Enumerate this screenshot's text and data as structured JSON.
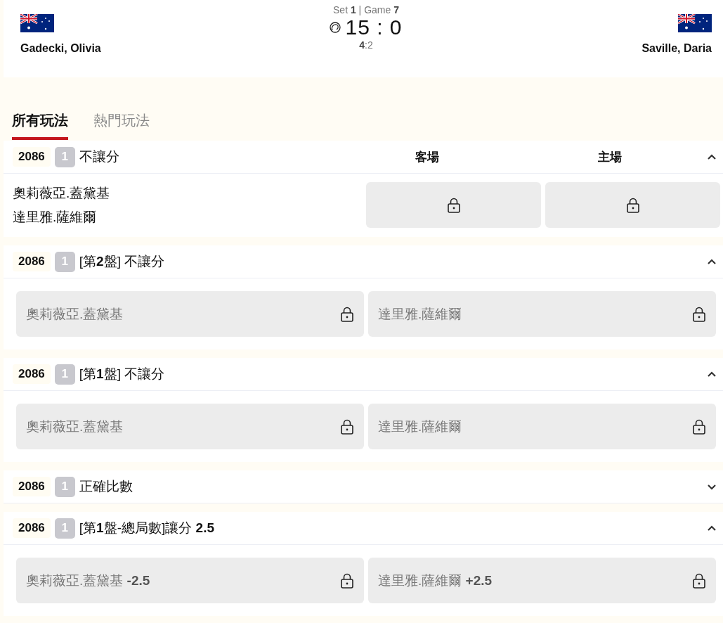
{
  "match": {
    "home": {
      "name": "Gadecki, Olivia",
      "serving": true
    },
    "away": {
      "name": "Saville, Daria",
      "serving": false
    },
    "set_info": "Set **1** | Game **7**",
    "score": "15 : 0",
    "games": "**4**:2"
  },
  "tabs": [
    {
      "label": "所有玩法",
      "selected": true
    },
    {
      "label": "熱門玩法",
      "selected": false
    }
  ],
  "markets": [
    {
      "kind": "table",
      "code": "2086",
      "badge": "1",
      "title": "不讓分",
      "expanded": true,
      "columns": [
        "客場",
        "主場"
      ],
      "teams": [
        "奧莉薇亞.蓋黛基",
        "達里雅.薩維爾"
      ],
      "cells": [
        {
          "locked": true
        },
        {
          "locked": true
        }
      ]
    },
    {
      "kind": "pair",
      "code": "2086",
      "badge": "1",
      "title": "[第**2**盤] 不讓分",
      "expanded": true,
      "options": [
        {
          "label": "奧莉薇亞.蓋黛基",
          "locked": true
        },
        {
          "label": "達里雅.薩維爾",
          "locked": true
        }
      ]
    },
    {
      "kind": "pair",
      "code": "2086",
      "badge": "1",
      "title": "[第**1**盤] 不讓分",
      "expanded": true,
      "options": [
        {
          "label": "奧莉薇亞.蓋黛基",
          "locked": true
        },
        {
          "label": "達里雅.薩維爾",
          "locked": true
        }
      ]
    },
    {
      "kind": "pair",
      "code": "2086",
      "badge": "1",
      "title": "正確比數",
      "expanded": false
    },
    {
      "kind": "pair",
      "code": "2086",
      "badge": "1",
      "title": "[第**1**盤-總局數]讓分 **2.5**",
      "expanded": true,
      "options": [
        {
          "label": "奧莉薇亞.蓋黛基 **-2.5**",
          "locked": true
        },
        {
          "label": "達里雅.薩維爾 **+2.5**",
          "locked": true
        }
      ]
    }
  ]
}
